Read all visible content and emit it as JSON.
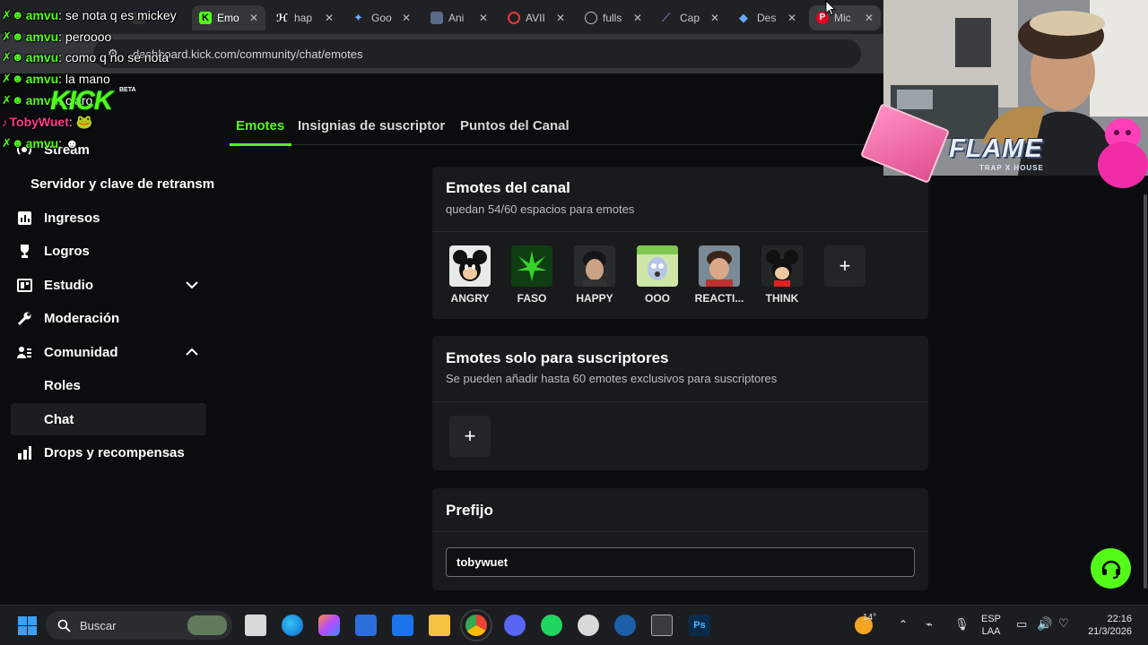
{
  "browser": {
    "tabs": [
      {
        "label": "",
        "icon": "kick-icon-faded"
      },
      {
        "label": "",
        "icon": "faded-tab-icon"
      },
      {
        "label": "Emo",
        "icon": "kick-icon"
      },
      {
        "label": "hap",
        "icon": "h-logo-icon"
      },
      {
        "label": "Goo",
        "icon": "gemini-icon"
      },
      {
        "label": "Ani",
        "icon": "anime-icon"
      },
      {
        "label": "AVII",
        "icon": "circle-icon"
      },
      {
        "label": "fulls",
        "icon": "globe-icon"
      },
      {
        "label": "Cap",
        "icon": "feather-icon"
      },
      {
        "label": "Des",
        "icon": "diamond-icon"
      },
      {
        "label": "Mic",
        "icon": "pinterest-icon"
      }
    ],
    "url": "dashboard.kick.com/community/chat/emotes"
  },
  "chat_overlay": {
    "lines": [
      {
        "user": "amvu",
        "message": ": se nota q es mickey"
      },
      {
        "user": "amvu",
        "message": ": peroooo"
      },
      {
        "user": "amvu",
        "message": ": como q no se nota"
      },
      {
        "user": "amvu",
        "message": ": la mano"
      },
      {
        "user": "amvu",
        "message": ": claro"
      },
      {
        "user": "TobyWuet",
        "message": ":"
      },
      {
        "user": "amvu",
        "message": ":"
      }
    ],
    "kick_logo": "KICK",
    "kick_badge": "BETA"
  },
  "sidebar": {
    "items": [
      {
        "label": "Stream",
        "icon": "stream-icon"
      },
      {
        "label": "Servidor y clave de retransm",
        "icon": ""
      },
      {
        "label": "Ingresos",
        "icon": "chart-icon"
      },
      {
        "label": "Logros",
        "icon": "trophy-icon"
      },
      {
        "label": "Estudio",
        "icon": "studio-icon"
      },
      {
        "label": "Moderación",
        "icon": "wrench-icon"
      },
      {
        "label": "Comunidad",
        "icon": "community-icon"
      },
      {
        "label": "Roles",
        "icon": ""
      },
      {
        "label": "Chat",
        "icon": ""
      },
      {
        "label": "Drops y recompensas",
        "icon": "drops-icon"
      }
    ]
  },
  "tabs": [
    "Emotes",
    "Insignias de suscriptor",
    "Puntos del Canal"
  ],
  "channel_emotes": {
    "title": "Emotes del canal",
    "subtitle": "quedan 54/60 espacios para emotes",
    "emotes": [
      "ANGRY",
      "FASO",
      "HAPPY",
      "OOO",
      "REACTI...",
      "THINK"
    ],
    "add_label": "+"
  },
  "sub_emotes": {
    "title": "Emotes solo para suscriptores",
    "subtitle": "Se pueden añadir hasta 60 emotes exclusivos para suscriptores",
    "add_label": "+"
  },
  "prefix": {
    "title": "Prefijo",
    "value": "tobywuet"
  },
  "webcam": {
    "brand_text": "FLAME",
    "brand_subtext": "TRAP X HOUSE"
  },
  "taskbar": {
    "search_label": "Buscar",
    "weather": "14°",
    "lang_line1": "ESP",
    "lang_line2": "LAA",
    "time": "22:16",
    "date": "21/3/2026"
  },
  "colors": {
    "accent": "#53fc18",
    "background": "#0b0c0d",
    "card": "#191a1c"
  }
}
